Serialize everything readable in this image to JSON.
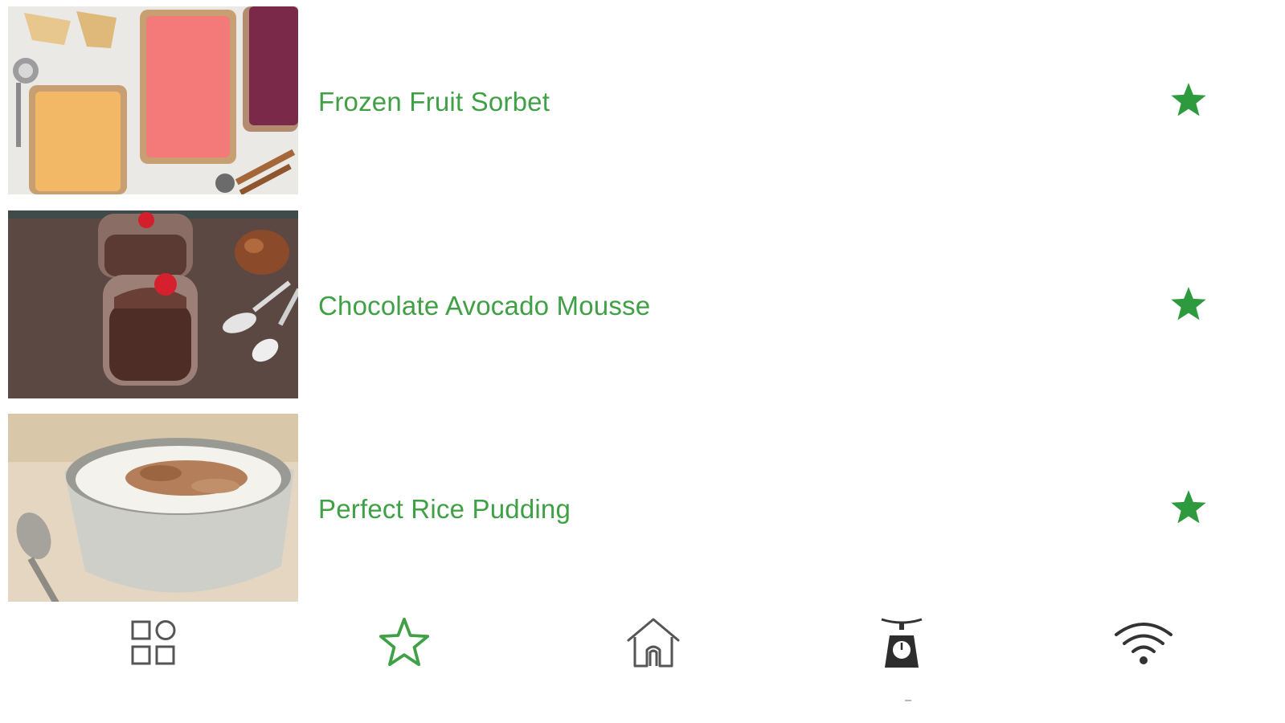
{
  "recipes": [
    {
      "title": "Frozen Fruit Sorbet",
      "favorite_icon": "star-filled-icon",
      "image": "sorbet-photo"
    },
    {
      "title": "Chocolate Avocado Mousse",
      "favorite_icon": "star-filled-icon",
      "image": "mousse-photo"
    },
    {
      "title": "Perfect Rice Pudding",
      "favorite_icon": "star-filled-icon",
      "image": "rice-pudding-photo"
    }
  ],
  "tabbar": {
    "tabs": [
      {
        "icon": "categories-grid-icon",
        "active": false
      },
      {
        "icon": "favorites-star-icon",
        "active": true
      },
      {
        "icon": "home-icon",
        "active": false
      },
      {
        "icon": "kitchen-scale-icon",
        "active": false
      },
      {
        "icon": "wifi-icon",
        "active": false
      }
    ]
  },
  "colors": {
    "accent_green": "#3fa045",
    "icon_gray": "#555555",
    "background": "#ffffff"
  }
}
